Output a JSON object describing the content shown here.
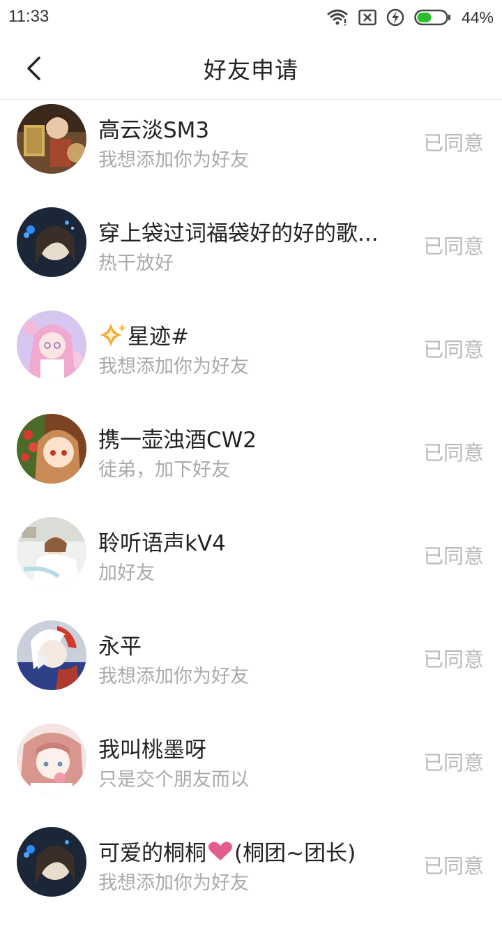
{
  "status_bar": {
    "time": "11:33",
    "battery": "44%",
    "icons": [
      "wifi-icon",
      "no-sim-icon",
      "charging-icon",
      "battery-icon"
    ],
    "battery_color": "#2cbf2c"
  },
  "header": {
    "title": "好友申请",
    "back_icon": "chevron-left-icon"
  },
  "colors": {
    "name": "#222222",
    "message": "#aaaaaa",
    "status": "#b9b9b9",
    "divider": "#e6e6e6"
  },
  "requests": [
    {
      "name": "高云淡SM3",
      "message": "我想添加你为好友",
      "status": "已同意"
    },
    {
      "name": "穿上袋过词福袋好的好的歌...",
      "message": "热干放好",
      "status": "已同意"
    },
    {
      "name": "星迹#",
      "name_prefix_icon": "sparkle-icon",
      "message": "我想添加你为好友",
      "status": "已同意"
    },
    {
      "name": "携一壶浊酒CW2",
      "message": "徒弟，加下好友",
      "status": "已同意"
    },
    {
      "name": "聆听语声kV4",
      "message": "加好友",
      "status": "已同意"
    },
    {
      "name": "永平",
      "message": "我想添加你为好友",
      "status": "已同意"
    },
    {
      "name": "我叫桃墨呀",
      "message": "只是交个朋友而以",
      "status": "已同意"
    },
    {
      "name": "可爱的桐桐",
      "name_suffix_icon": "heart-icon",
      "name_suffix": "(桐团~团长)",
      "message": "我想添加你为好友",
      "status": "已同意"
    }
  ]
}
